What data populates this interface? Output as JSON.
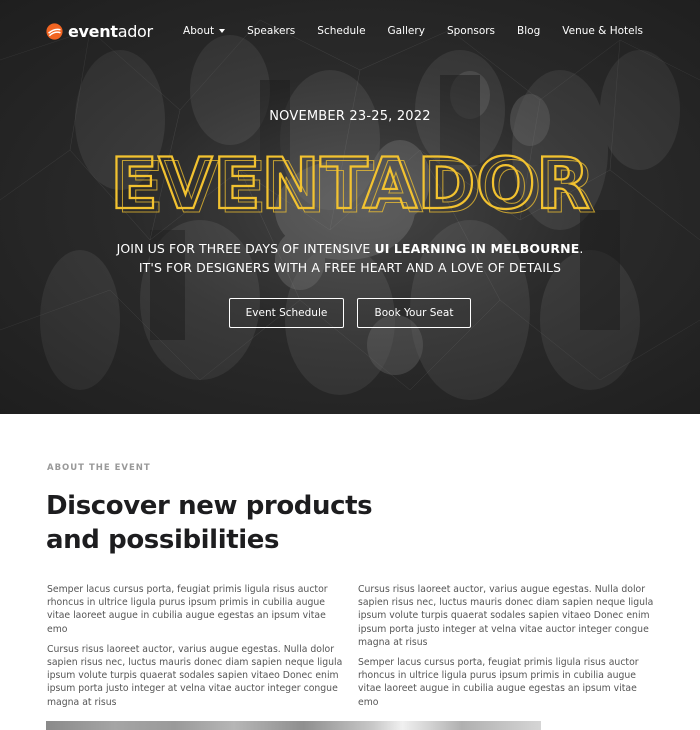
{
  "brand": {
    "name_bold": "event",
    "name_rest": "ador",
    "accent_color": "#f26522"
  },
  "nav": {
    "items": [
      {
        "label": "About",
        "has_dropdown": true
      },
      {
        "label": "Speakers"
      },
      {
        "label": "Schedule"
      },
      {
        "label": "Gallery"
      },
      {
        "label": "Sponsors"
      },
      {
        "label": "Blog"
      },
      {
        "label": "Venue & Hotels"
      }
    ]
  },
  "hero": {
    "date": "NOVEMBER 23-25, 2022",
    "title": "EVENTADOR",
    "title_color": "#f2c230",
    "sub1_plain": "JOIN US FOR THREE DAYS OF INTENSIVE ",
    "sub1_bold": "UI LEARNING IN MELBOURNE",
    "sub1_end": ".",
    "sub2": "IT'S FOR DESIGNERS WITH A FREE HEART AND A LOVE OF DETAILS",
    "buttons": {
      "schedule": "Event Schedule",
      "book": "Book Your Seat"
    }
  },
  "about": {
    "eyebrow": "ABOUT THE EVENT",
    "title": "Discover new products and possibilities",
    "left": [
      "Semper lacus cursus porta, feugiat primis ligula risus auctor rhoncus in ultrice ligula purus ipsum primis in cubilia augue vitae laoreet augue in cubilia augue egestas an ipsum vitae emo",
      "Cursus risus laoreet auctor, varius augue egestas. Nulla dolor sapien risus nec, luctus mauris donec diam sapien neque ligula ipsum volute turpis quaerat sodales sapien vitaeo Donec enim ipsum porta justo integer at velna vitae auctor integer congue magna at risus"
    ],
    "right": [
      "Cursus risus laoreet auctor, varius augue egestas. Nulla dolor sapien risus nec, luctus mauris donec diam sapien neque ligula ipsum volute turpis quaerat sodales sapien vitaeo Donec enim ipsum porta justo integer at velna vitae auctor integer congue magna at risus",
      "Semper lacus cursus porta, feugiat primis ligula risus auctor rhoncus in ultrice ligula purus ipsum primis in cubilia augue vitae laoreet augue in cubilia augue egestas an ipsum vitae emo"
    ]
  }
}
